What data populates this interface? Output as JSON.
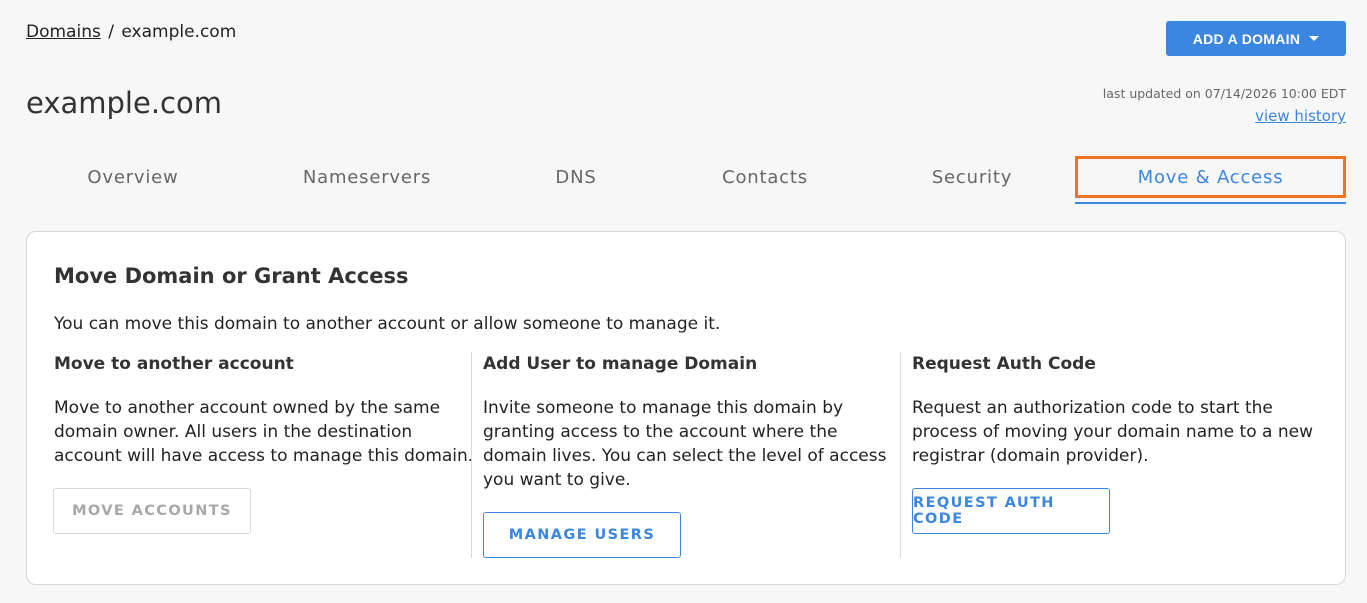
{
  "breadcrumb": {
    "root_label": "Domains",
    "separator": "/",
    "current": "example.com"
  },
  "header": {
    "add_domain_label": "ADD A DOMAIN",
    "title": "example.com",
    "last_updated": "last updated on 07/14/2026 10:00 EDT",
    "view_history_label": "view history"
  },
  "tabs": [
    {
      "label": "Overview",
      "active": false
    },
    {
      "label": "Nameservers",
      "active": false
    },
    {
      "label": "DNS",
      "active": false
    },
    {
      "label": "Contacts",
      "active": false
    },
    {
      "label": "Security",
      "active": false
    },
    {
      "label": "Move & Access",
      "active": true
    }
  ],
  "card": {
    "title": "Move Domain or Grant Access",
    "intro": "You can move this domain to another account or allow someone to manage it.",
    "columns": [
      {
        "title": "Move to another account",
        "text": "Move to another account owned by the same domain owner. All users in the destination account will have access to manage this domain.",
        "button_label": "MOVE ACCOUNTS",
        "button_disabled": true
      },
      {
        "title": "Add User to manage Domain",
        "text": "Invite someone to manage this domain by granting access to the account where the domain lives. You can select the level of access you want to give.",
        "button_label": "MANAGE USERS",
        "button_disabled": false
      },
      {
        "title": "Request Auth Code",
        "text": "Request an authorization code to start the process of moving your domain name to a new registrar (domain provider).",
        "button_label": "REQUEST AUTH CODE",
        "button_disabled": false
      }
    ]
  },
  "colors": {
    "accent": "#3b86e0",
    "highlight": "#f07522",
    "background": "#f7f7f7"
  }
}
